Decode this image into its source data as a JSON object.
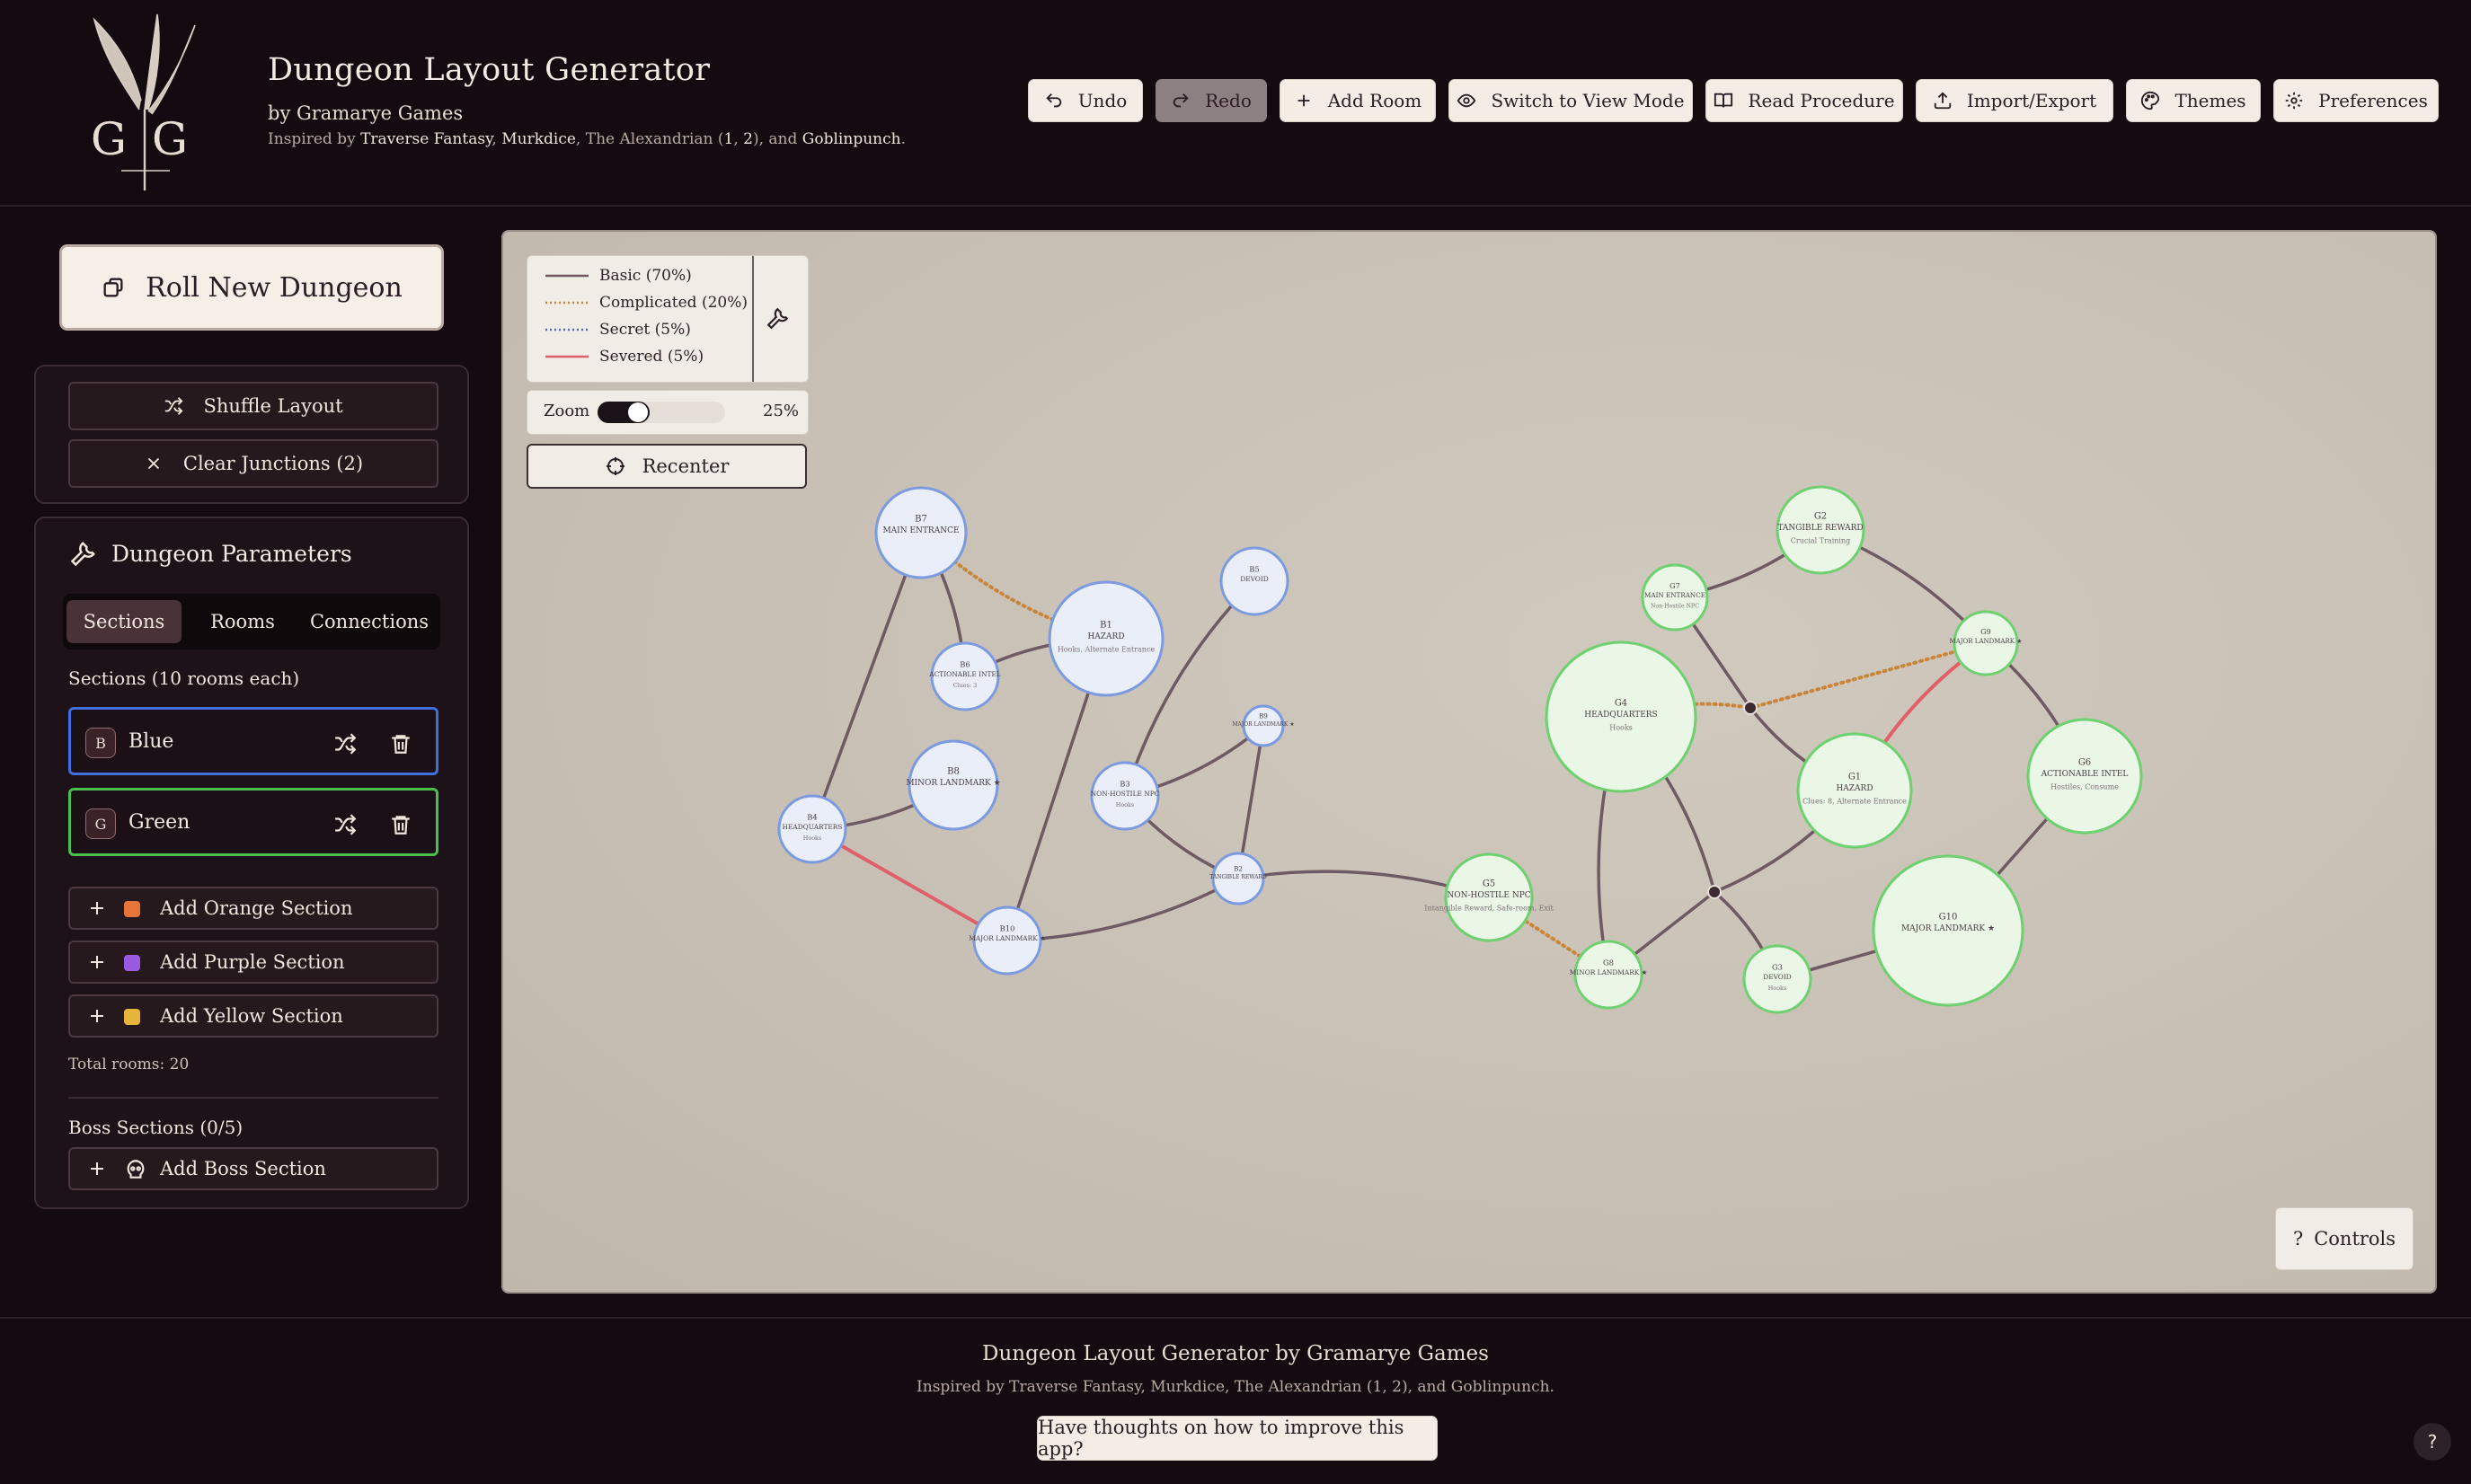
{
  "app": {
    "title": "Dungeon Layout Generator",
    "byline": "by Gramarye Games",
    "inspired_prefix": "Inspired by ",
    "inspired_links": [
      "Traverse Fantasy",
      "Murkdice",
      "The Alexandrian",
      "1",
      "2",
      "Goblinpunch"
    ],
    "inspired_text": "Inspired by Traverse Fantasy, Murkdice, The Alexandrian (1, 2), and Goblinpunch.",
    "logo_text": "GG"
  },
  "toolbar": {
    "undo": "Undo",
    "redo": "Redo",
    "add_room": "Add Room",
    "view_mode": "Switch to View Mode",
    "read_procedure": "Read Procedure",
    "import_export": "Import/Export",
    "themes": "Themes",
    "preferences": "Preferences"
  },
  "sidebar": {
    "roll": "Roll New Dungeon",
    "shuffle": "Shuffle Layout",
    "clear_junctions": "Clear Junctions (2)",
    "params_title": "Dungeon Parameters",
    "tabs": [
      "Sections",
      "Rooms",
      "Connections"
    ],
    "active_tab": "Sections",
    "sections_label": "Sections (10 rooms each)",
    "sections": [
      {
        "badge": "B",
        "name": "Blue",
        "color": "#3f6fdd"
      },
      {
        "badge": "G",
        "name": "Green",
        "color": "#4bbf4b"
      }
    ],
    "add_sections": [
      {
        "label": "Add Orange Section",
        "color": "#e8743a"
      },
      {
        "label": "Add Purple Section",
        "color": "#9a5ae0"
      },
      {
        "label": "Add Yellow Section",
        "color": "#e6b43a"
      }
    ],
    "total_rooms": "Total rooms: 20",
    "boss_label": "Boss Sections (0/5)",
    "add_boss": "Add Boss Section"
  },
  "legend": {
    "items": [
      {
        "label": "Basic (70%)",
        "color": "#6e5a62",
        "style": "solid"
      },
      {
        "label": "Complicated (20%)",
        "color": "#c9853a",
        "style": "dotted"
      },
      {
        "label": "Secret (5%)",
        "color": "#4a6fd0",
        "style": "dotted"
      },
      {
        "label": "Severed (5%)",
        "color": "#e0606a",
        "style": "solid"
      }
    ]
  },
  "zoom": {
    "label": "Zoom",
    "value": "25%",
    "fraction": 0.25
  },
  "canvas": {
    "recenter": "Recenter",
    "controls": "Controls",
    "controls_icon": "?"
  },
  "rooms": [
    {
      "id": "B7",
      "title": "MAIN ENTRANCE",
      "sub": "",
      "section": "blue"
    },
    {
      "id": "B1",
      "title": "HAZARD",
      "sub": "Hooks, Alternate Entrance",
      "section": "blue"
    },
    {
      "id": "B6",
      "title": "ACTIONABLE INTEL",
      "sub": "Clues: 3",
      "section": "blue"
    },
    {
      "id": "B5",
      "title": "DEVOID",
      "sub": "",
      "section": "blue"
    },
    {
      "id": "B9",
      "title": "MAJOR LANDMARK ★",
      "sub": "",
      "section": "blue"
    },
    {
      "id": "B8",
      "title": "MINOR LANDMARK ★",
      "sub": "",
      "section": "blue"
    },
    {
      "id": "B3",
      "title": "NON-HOSTILE NPC",
      "sub": "Hooks",
      "section": "blue"
    },
    {
      "id": "B4",
      "title": "HEADQUARTERS",
      "sub": "Hooks",
      "section": "blue"
    },
    {
      "id": "B2",
      "title": "TANGIBLE REWARD",
      "sub": "",
      "section": "blue"
    },
    {
      "id": "B10",
      "title": "MAJOR LANDMARK ★",
      "sub": "",
      "section": "blue"
    },
    {
      "id": "G2",
      "title": "TANGIBLE REWARD",
      "sub": "Crucial Training",
      "section": "green"
    },
    {
      "id": "G7",
      "title": "MAIN ENTRANCE",
      "sub": "Non-Hostile NPC",
      "section": "green"
    },
    {
      "id": "G9",
      "title": "MAJOR LANDMARK ★",
      "sub": "",
      "section": "green"
    },
    {
      "id": "G4",
      "title": "HEADQUARTERS",
      "sub": "Hooks",
      "section": "green"
    },
    {
      "id": "G1",
      "title": "HAZARD",
      "sub": "Clues: 8, Alternate Entrance",
      "section": "green"
    },
    {
      "id": "G6",
      "title": "ACTIONABLE INTEL",
      "sub": "Hostiles, Consume",
      "section": "green"
    },
    {
      "id": "G5",
      "title": "NON-HOSTILE NPC",
      "sub": "Intangible Reward, Safe-room, Exit",
      "section": "green"
    },
    {
      "id": "G8",
      "title": "MINOR LANDMARK ★",
      "sub": "",
      "section": "green"
    },
    {
      "id": "G3",
      "title": "DEVOID",
      "sub": "Hooks",
      "section": "green"
    },
    {
      "id": "G10",
      "title": "MAJOR LANDMARK ★",
      "sub": "",
      "section": "green"
    }
  ],
  "connections": [
    [
      "B7",
      "B6",
      "basic"
    ],
    [
      "B7",
      "B4",
      "basic"
    ],
    [
      "B7",
      "B1",
      "complicated"
    ],
    [
      "B6",
      "B1",
      "basic"
    ],
    [
      "B1",
      "B10",
      "basic"
    ],
    [
      "B5",
      "B3",
      "basic"
    ],
    [
      "B9",
      "B3",
      "basic"
    ],
    [
      "B9",
      "B2",
      "basic"
    ],
    [
      "B3",
      "B2",
      "basic"
    ],
    [
      "B8",
      "B4",
      "basic"
    ],
    [
      "B4",
      "B10",
      "severed"
    ],
    [
      "B10",
      "B2",
      "basic"
    ],
    [
      "B2",
      "G5",
      "basic"
    ],
    [
      "G5",
      "G8",
      "complicated"
    ],
    [
      "G7",
      "G2",
      "basic"
    ],
    [
      "G2",
      "G9",
      "basic"
    ],
    [
      "G7",
      "J1",
      "basic"
    ],
    [
      "J1",
      "G1",
      "basic"
    ],
    [
      "G4",
      "J1",
      "complicated"
    ],
    [
      "J1",
      "G9",
      "complicated"
    ],
    [
      "G9",
      "G1",
      "severed"
    ],
    [
      "G9",
      "G6",
      "basic"
    ],
    [
      "G6",
      "G10",
      "basic"
    ],
    [
      "G4",
      "G8",
      "basic"
    ],
    [
      "G4",
      "J2",
      "basic"
    ],
    [
      "J2",
      "G8",
      "basic"
    ],
    [
      "J2",
      "G1",
      "basic"
    ],
    [
      "J2",
      "G3",
      "basic"
    ],
    [
      "G3",
      "G10",
      "basic"
    ]
  ],
  "footer": {
    "title": "Dungeon Layout Generator by Gramarye Games",
    "inspired": "Inspired by Traverse Fantasy, Murkdice, The Alexandrian (1, 2), and Goblinpunch.",
    "feedback": "Have thoughts on how to improve this app?",
    "help": "?"
  },
  "colors": {
    "background": "#130b10",
    "blue_stroke": "#7b9ae0",
    "blue_fill": "#e9eef9",
    "green_stroke": "#6fd06f",
    "green_fill": "#eaf6e6",
    "canvas": "#c8c0b4"
  }
}
